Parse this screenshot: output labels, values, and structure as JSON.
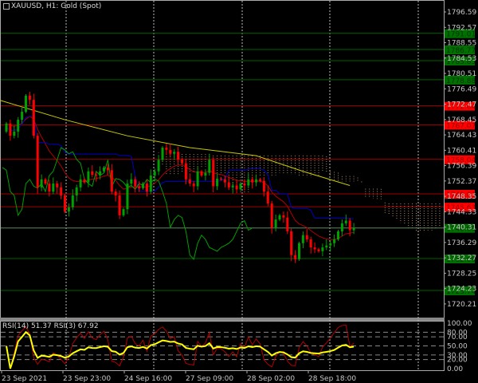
{
  "header": {
    "title": "XAUUSD, H1:  Gold (Spot)",
    "icon": "chart-window-icon"
  },
  "rsi_panel": {
    "title": "RSI(14) 51.37 RSI(3) 67.92"
  },
  "colors": {
    "bull": "#00a000",
    "bear": "#ff0000",
    "ma_slow": "#c8c800",
    "ma_fast": "#b00000",
    "kijun": "#0000c0",
    "chikou": "#00a000",
    "cloud": "#b08a6a",
    "rsi14": "#ffff00",
    "rsi3": "#b00000",
    "support": "#006400",
    "resistance": "#8b0000"
  },
  "chart_data": {
    "type": "candlestick",
    "symbol": "XAUUSD",
    "timeframe": "H1",
    "ylim": [
      1718.5,
      1799.0
    ],
    "y_ticks": [
      "1796.59",
      "1792.57",
      "1788.55",
      "1784.53",
      "1780.51",
      "1776.49",
      "1772.47",
      "1768.45",
      "1764.43",
      "1760.41",
      "1756.39",
      "1752.37",
      "1748.35",
      "1744.33",
      "1740.31",
      "1736.29",
      "1732.27",
      "1728.25",
      "1724.23",
      "1720.21"
    ],
    "x_ticks": [
      "23 Sep 2021",
      "23 Sep 23:00",
      "24 Sep 16:00",
      "27 Sep 09:00",
      "28 Sep 02:00",
      "28 Sep 18:00"
    ],
    "open_first": 1765.3,
    "closes": [
      1767.4,
      1764.2,
      1765.3,
      1768.4,
      1770.5,
      1774.7,
      1773.6,
      1764.2,
      1750.7,
      1752.8,
      1751.7,
      1749.6,
      1751.7,
      1750.7,
      1748.6,
      1744.4,
      1745.5,
      1748.6,
      1750.7,
      1752.8,
      1752.0,
      1754.9,
      1754.0,
      1753.8,
      1754.9,
      1755.9,
      1755.2,
      1749.6,
      1748.6,
      1743.4,
      1745.0,
      1751.7,
      1752.8,
      1751.0,
      1750.5,
      1751.7,
      1749.6,
      1753.8,
      1754.9,
      1757.9,
      1761.1,
      1760.5,
      1759.5,
      1760.0,
      1758.0,
      1757.0,
      1752.8,
      1751.7,
      1751.0,
      1754.9,
      1753.8,
      1754.5,
      1757.9,
      1751.0,
      1753.0,
      1752.8,
      1752.0,
      1750.7,
      1751.2,
      1750.2,
      1751.7,
      1751.2,
      1752.8,
      1752.0,
      1752.8,
      1752.4,
      1749.6,
      1746.5,
      1740.2,
      1742.3,
      1743.4,
      1742.8,
      1739.2,
      1733.0,
      1731.9,
      1736.1,
      1738.2,
      1737.1,
      1735.0,
      1734.5,
      1734.0,
      1735.0,
      1735.5,
      1736.1,
      1737.1,
      1739.2,
      1741.3,
      1742.0,
      1739.5,
      1740.09
    ],
    "ma_slow_points": [
      [
        -2,
        1773.6
      ],
      [
        15,
        1768.4
      ],
      [
        31,
        1764.2
      ],
      [
        47,
        1761.1
      ],
      [
        64,
        1759.0
      ],
      [
        76,
        1754.9
      ],
      [
        88,
        1751.2
      ]
    ],
    "levels": [
      {
        "price": "1791.01",
        "kind": "support"
      },
      {
        "price": "1786.77",
        "kind": "support"
      },
      {
        "price": "1783.85",
        "kind": "support"
      },
      {
        "price": "1778.88",
        "kind": "support"
      },
      {
        "price": "1772.04",
        "kind": "resistance"
      },
      {
        "price": "1767.07",
        "kind": "resistance"
      },
      {
        "price": "1758.04",
        "kind": "resistance"
      },
      {
        "price": "1749.01",
        "kind": "resistance"
      },
      {
        "price": "1745.63",
        "kind": "resistance"
      },
      {
        "price": "1740.09",
        "kind": "current"
      },
      {
        "price": "1732.09",
        "kind": "support"
      },
      {
        "price": "1723.74",
        "kind": "support"
      }
    ],
    "rsi": {
      "ylim": [
        0,
        100
      ],
      "ticks": [
        "100.00",
        "80.00",
        "70.00",
        "50.00",
        "30.00",
        "20.00",
        "0.00"
      ],
      "rsi14_last": 51.37,
      "rsi3_last": 67.92
    }
  }
}
